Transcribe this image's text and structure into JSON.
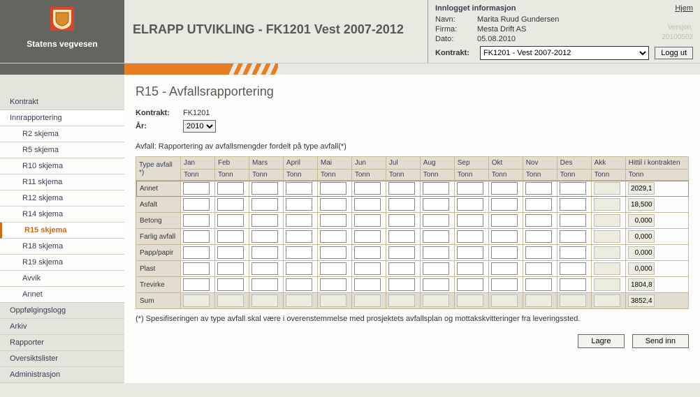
{
  "brand": {
    "name": "Statens vegvesen"
  },
  "app_title": "ELRAPP UTVIKLING - FK1201 Vest 2007-2012",
  "info": {
    "title": "Innlogget informasjon",
    "home": "Hjem",
    "name_label": "Navn:",
    "name": "Marita Ruud Gundersen",
    "firm_label": "Firma:",
    "firm": "Mesta Drift AS",
    "date_label": "Dato:",
    "date": "05.08.2010",
    "version_label": "Versjon:",
    "version_value": "20100502",
    "contract_label": "Kontrakt:",
    "contract_selected": "FK1201 - Vest 2007-2012",
    "logout": "Logg ut"
  },
  "sidebar": {
    "items": [
      {
        "label": "Kontrakt",
        "type": "section"
      },
      {
        "label": "Innrapportering",
        "type": "section-open"
      },
      {
        "label": "R2 skjema",
        "type": "sub"
      },
      {
        "label": "R5 skjema",
        "type": "sub"
      },
      {
        "label": "R10 skjema",
        "type": "sub"
      },
      {
        "label": "R11 skjema",
        "type": "sub"
      },
      {
        "label": "R12 skjema",
        "type": "sub"
      },
      {
        "label": "R14 skjema",
        "type": "sub"
      },
      {
        "label": "R15 skjema",
        "type": "sub-active"
      },
      {
        "label": "R18 skjema",
        "type": "sub"
      },
      {
        "label": "R19 skjema",
        "type": "sub"
      },
      {
        "label": "Avvik",
        "type": "sub"
      },
      {
        "label": "Annet",
        "type": "sub"
      },
      {
        "label": "Oppfølgingslogg",
        "type": "section"
      },
      {
        "label": "Arkiv",
        "type": "section"
      },
      {
        "label": "Rapporter",
        "type": "section"
      },
      {
        "label": "Oversiktslister",
        "type": "section"
      },
      {
        "label": "Administrasjon",
        "type": "section"
      }
    ]
  },
  "page": {
    "title": "R15 - Avfallsrapportering",
    "contract_label": "Kontrakt:",
    "contract_value": "FK1201",
    "year_label": "År:",
    "year_value": "2010",
    "description": "Avfall: Rapportering av avfallsmengder fordelt på type avfall(*)",
    "footnote": "(*) Spesifiseringen av type avfall skal være i overenstemmelse med prosjektets avfallsplan og mottakskvitteringer fra leveringssted.",
    "save": "Lagre",
    "send": "Send inn"
  },
  "table": {
    "type_header": "Type avfall *)",
    "months": [
      "Jan",
      "Feb",
      "Mars",
      "April",
      "Mai",
      "Jun",
      "Jul",
      "Aug",
      "Sep",
      "Okt",
      "Nov",
      "Des"
    ],
    "akk": "Akk",
    "total_header": "Hittil i kontrakten",
    "unit": "Tonn",
    "rows": [
      {
        "name": "Annet",
        "total": "2029,1"
      },
      {
        "name": "Asfalt",
        "total": "18,500"
      },
      {
        "name": "Betong",
        "total": "0,000"
      },
      {
        "name": "Farlig avfall",
        "total": "0,000"
      },
      {
        "name": "Papp/papir",
        "total": "0,000"
      },
      {
        "name": "Plast",
        "total": "0,000"
      },
      {
        "name": "Trevirke",
        "total": "1804,8"
      }
    ],
    "sum_label": "Sum",
    "sum_total": "3852,4"
  },
  "chart_data": {
    "type": "table",
    "title": "R15 - Avfallsrapportering",
    "columns": [
      "Type avfall",
      "Jan",
      "Feb",
      "Mars",
      "April",
      "Mai",
      "Jun",
      "Jul",
      "Aug",
      "Sep",
      "Okt",
      "Nov",
      "Des",
      "Akk",
      "Hittil i kontrakten"
    ],
    "unit": "Tonn",
    "rows": [
      {
        "name": "Annet",
        "months": [
          null,
          null,
          null,
          null,
          null,
          null,
          null,
          null,
          null,
          null,
          null,
          null
        ],
        "akk": null,
        "hittil": 2029.1
      },
      {
        "name": "Asfalt",
        "months": [
          null,
          null,
          null,
          null,
          null,
          null,
          null,
          null,
          null,
          null,
          null,
          null
        ],
        "akk": null,
        "hittil": 18.5
      },
      {
        "name": "Betong",
        "months": [
          null,
          null,
          null,
          null,
          null,
          null,
          null,
          null,
          null,
          null,
          null,
          null
        ],
        "akk": null,
        "hittil": 0.0
      },
      {
        "name": "Farlig avfall",
        "months": [
          null,
          null,
          null,
          null,
          null,
          null,
          null,
          null,
          null,
          null,
          null,
          null
        ],
        "akk": null,
        "hittil": 0.0
      },
      {
        "name": "Papp/papir",
        "months": [
          null,
          null,
          null,
          null,
          null,
          null,
          null,
          null,
          null,
          null,
          null,
          null
        ],
        "akk": null,
        "hittil": 0.0
      },
      {
        "name": "Plast",
        "months": [
          null,
          null,
          null,
          null,
          null,
          null,
          null,
          null,
          null,
          null,
          null,
          null
        ],
        "akk": null,
        "hittil": 0.0
      },
      {
        "name": "Trevirke",
        "months": [
          null,
          null,
          null,
          null,
          null,
          null,
          null,
          null,
          null,
          null,
          null,
          null
        ],
        "akk": null,
        "hittil": 1804.8
      }
    ],
    "sum": {
      "months": [
        null,
        null,
        null,
        null,
        null,
        null,
        null,
        null,
        null,
        null,
        null,
        null
      ],
      "akk": null,
      "hittil": 3852.4
    }
  }
}
